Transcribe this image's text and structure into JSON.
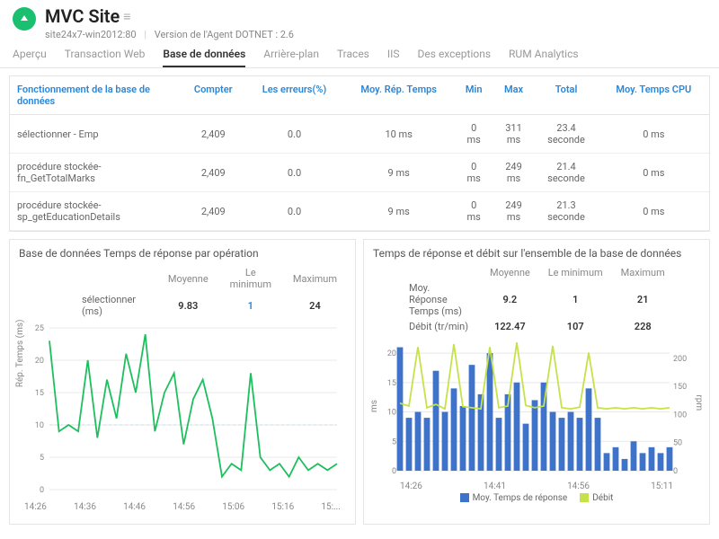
{
  "header": {
    "title": "MVC Site",
    "host": "site24x7-win2012:80",
    "agent": "Version de l'Agent DOTNET : 2.6"
  },
  "tabs": {
    "items": [
      "Aperçu",
      "Transaction Web",
      "Base de données",
      "Arrière-plan",
      "Traces",
      "IIS",
      "Des exceptions",
      "RUM Analytics"
    ],
    "active": 2
  },
  "table": {
    "cols": [
      "Fonctionnement de la base de données",
      "Compter",
      "Les erreurs(%)",
      "Moy. Rép. Temps",
      "Min",
      "Max",
      "Total",
      "Moy. Temps CPU"
    ],
    "rows": [
      {
        "op": "sélectionner - Emp",
        "count": "2,409",
        "err": "0.0",
        "avg": "10 ms",
        "min": "0 ms",
        "max": "311 ms",
        "total": "23.4 seconde",
        "cpu": "0 ms"
      },
      {
        "op": "procédure stockée-fn_GetTotalMarks",
        "count": "2,409",
        "err": "0.0",
        "avg": "9 ms",
        "min": "0 ms",
        "max": "249 ms",
        "total": "21.4 seconde",
        "cpu": "0 ms"
      },
      {
        "op": "procédure stockée-sp_getEducationDetails",
        "count": "2,409",
        "err": "0.0",
        "avg": "9 ms",
        "min": "0 ms",
        "max": "249 ms",
        "total": "21.3 seconde",
        "cpu": "0 ms"
      }
    ]
  },
  "chart_left": {
    "title": "Base de données Temps de réponse par opération",
    "stat_headers": [
      "Moyenne",
      "Le minimum",
      "Maximum"
    ],
    "series_label": "sélectionner (ms)",
    "stats": [
      "9.83",
      "1",
      "24"
    ],
    "ylabel": "Rép. Temps (ms)"
  },
  "chart_right": {
    "title": "Temps de réponse et débit sur l'ensemble de la base de données",
    "stat_headers": [
      "Moyenne",
      "Le minimum",
      "Maximum"
    ],
    "row1_label": "Moy. Réponse Temps (ms)",
    "row2_label": "Débit (tr/min)",
    "row1": [
      "9.2",
      "1",
      "21"
    ],
    "row2": [
      "122.47",
      "107",
      "228"
    ],
    "ylabel_left": "ms",
    "ylabel_right": "rpm",
    "legend_a": "Moy. Temps de réponse",
    "legend_b": "Débit"
  },
  "xticks": [
    "14:26",
    "14:36",
    "14:46",
    "14:56",
    "15:06",
    "15:16",
    "15:..."
  ],
  "xticks_right": [
    "14:26",
    "14:41",
    "14:56",
    "15:11"
  ],
  "colors": {
    "line_green": "#1dbf5e",
    "lime": "#c6e24a",
    "bar_blue": "#3e73c9",
    "grid": "#e8e8e8",
    "dashed": "#bcdff2"
  },
  "chart_data": [
    {
      "type": "line",
      "title": "Base de données Temps de réponse par opération",
      "ylabel": "Rép. Temps (ms)",
      "ylim": [
        0,
        25
      ],
      "x": [
        "14:26",
        "14:28",
        "14:30",
        "14:32",
        "14:34",
        "14:36",
        "14:38",
        "14:40",
        "14:42",
        "14:44",
        "14:46",
        "14:48",
        "14:50",
        "14:52",
        "14:54",
        "14:56",
        "14:58",
        "15:00",
        "15:02",
        "15:04",
        "15:06",
        "15:08",
        "15:10",
        "15:12",
        "15:14",
        "15:16",
        "15:18",
        "15:20",
        "15:22",
        "15:24",
        "15:26"
      ],
      "series": [
        {
          "name": "sélectionner (ms)",
          "values": [
            23,
            9,
            10,
            9,
            20,
            8,
            17,
            11,
            21,
            15,
            24,
            9,
            15,
            18,
            7,
            14,
            17,
            11,
            2,
            4,
            3,
            18,
            5,
            3,
            4,
            2,
            5,
            3,
            4,
            3,
            4
          ]
        }
      ]
    },
    {
      "type": "bar+line",
      "title": "Temps de réponse et débit sur l'ensemble de la base de données",
      "ylabel": "ms",
      "y2label": "rpm",
      "ylim": [
        0,
        22
      ],
      "y2lim": [
        0,
        230
      ],
      "x": [
        "14:26",
        "14:28",
        "14:30",
        "14:32",
        "14:34",
        "14:36",
        "14:38",
        "14:40",
        "14:42",
        "14:44",
        "14:46",
        "14:48",
        "14:50",
        "14:52",
        "14:54",
        "14:56",
        "14:58",
        "15:00",
        "15:02",
        "15:04",
        "15:06",
        "15:08",
        "15:10",
        "15:12",
        "15:14",
        "15:16",
        "15:18",
        "15:20",
        "15:22",
        "15:24",
        "15:26"
      ],
      "series": [
        {
          "name": "Moy. Temps de réponse",
          "type": "bar",
          "values": [
            21,
            9,
            10,
            9,
            17,
            10,
            14,
            11,
            18,
            13,
            20,
            9,
            13,
            15,
            8,
            12,
            15,
            10,
            9,
            10,
            9,
            14,
            9,
            3,
            4,
            2,
            5,
            3,
            4,
            3,
            4
          ]
        },
        {
          "name": "Débit",
          "type": "line",
          "axis": "y2",
          "values": [
            120,
            115,
            220,
            112,
            118,
            110,
            225,
            114,
            112,
            110,
            220,
            112,
            115,
            228,
            116,
            112,
            115,
            222,
            112,
            110,
            113,
            210,
            112,
            110,
            112,
            110,
            112,
            110,
            112,
            110,
            112
          ]
        }
      ]
    }
  ]
}
